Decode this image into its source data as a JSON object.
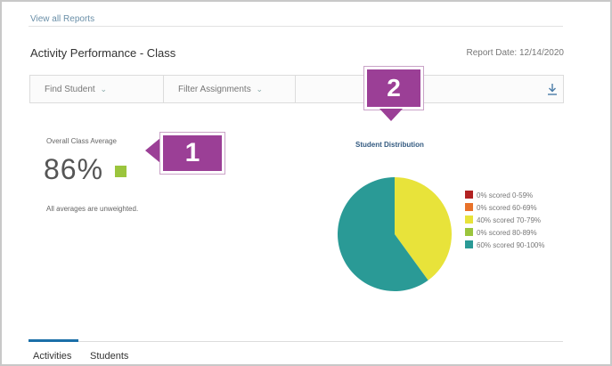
{
  "header": {
    "view_all_link": "View all Reports",
    "title": "Activity Performance - Class",
    "report_date": "Report Date: 12/14/2020"
  },
  "filters": {
    "find_student": "Find Student",
    "filter_assignments": "Filter Assignments",
    "chevron_icon": "chevron-down-icon",
    "download_icon": "download-icon"
  },
  "average": {
    "label": "Overall Class Average",
    "value": "86%",
    "indicator_color": "#9bc53d",
    "note": "All averages are unweighted."
  },
  "callouts": {
    "one": "1",
    "two": "2",
    "color": "#9b3f96"
  },
  "distribution": {
    "title": "Student Distribution"
  },
  "chart_data": {
    "type": "pie",
    "title": "Student Distribution",
    "labels": [
      "0% scored 0-59%",
      "0% scored 60-69%",
      "40% scored 70-79%",
      "0% scored 80-89%",
      "60% scored 90-100%"
    ],
    "values": [
      0,
      0,
      40,
      0,
      60
    ],
    "colors": [
      "#b22222",
      "#e8722a",
      "#e8e33a",
      "#9bc53d",
      "#2a9a96"
    ]
  },
  "tabs": {
    "activities": "Activities",
    "students": "Students"
  }
}
